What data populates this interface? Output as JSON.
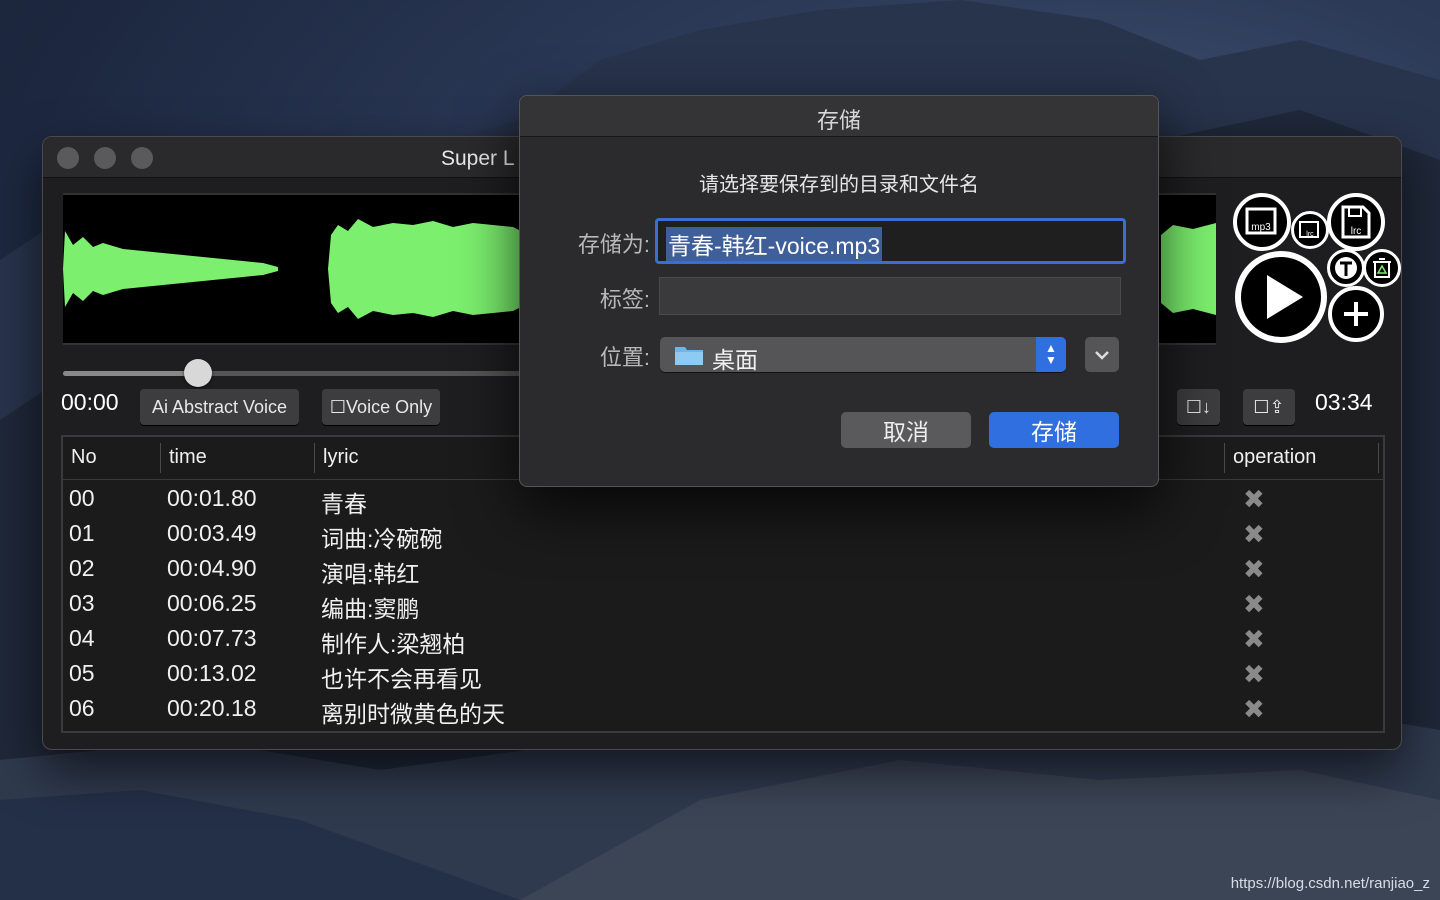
{
  "desktop": {
    "watermark": "https://blog.csdn.net/ranjiao_z"
  },
  "app": {
    "title": "Super L",
    "current_time": "00:00",
    "total_time": "03:34",
    "ai_button": "Ai Abstract Voice",
    "voice_only": "☐Voice Only",
    "down_btn": "☐↓",
    "upload_btn": "☐⇪",
    "icons": {
      "mp3": "mp3",
      "lrc": "lrc",
      "lrc2": "lrc"
    },
    "table": {
      "headers": {
        "no": "No",
        "time": "time",
        "lyric": "lyric",
        "operation": "operation"
      },
      "rows": [
        {
          "no": "00",
          "time": "00:01.80",
          "lyric": "青春"
        },
        {
          "no": "01",
          "time": "00:03.49",
          "lyric": "词曲:冷碗碗"
        },
        {
          "no": "02",
          "time": "00:04.90",
          "lyric": "演唱:韩红"
        },
        {
          "no": "03",
          "time": "00:06.25",
          "lyric": "编曲:窦鹏"
        },
        {
          "no": "04",
          "time": "00:07.73",
          "lyric": "制作人:梁翘柏"
        },
        {
          "no": "05",
          "time": "00:13.02",
          "lyric": "也许不会再看见"
        },
        {
          "no": "06",
          "time": "00:20.18",
          "lyric": "离别时微黄色的天"
        }
      ],
      "delete_icon": "✖"
    },
    "colors": {
      "waveform": "#7cf06e"
    }
  },
  "dialog": {
    "title": "存储",
    "message": "请选择要保存到的目录和文件名",
    "save_as_label": "存储为:",
    "filename": "青春-韩红-voice.mp3",
    "tags_label": "标签:",
    "tags_value": "",
    "location_label": "位置:",
    "location_value": "桌面",
    "cancel": "取消",
    "save": "存储",
    "colors": {
      "accent": "#2f6fe0"
    }
  }
}
